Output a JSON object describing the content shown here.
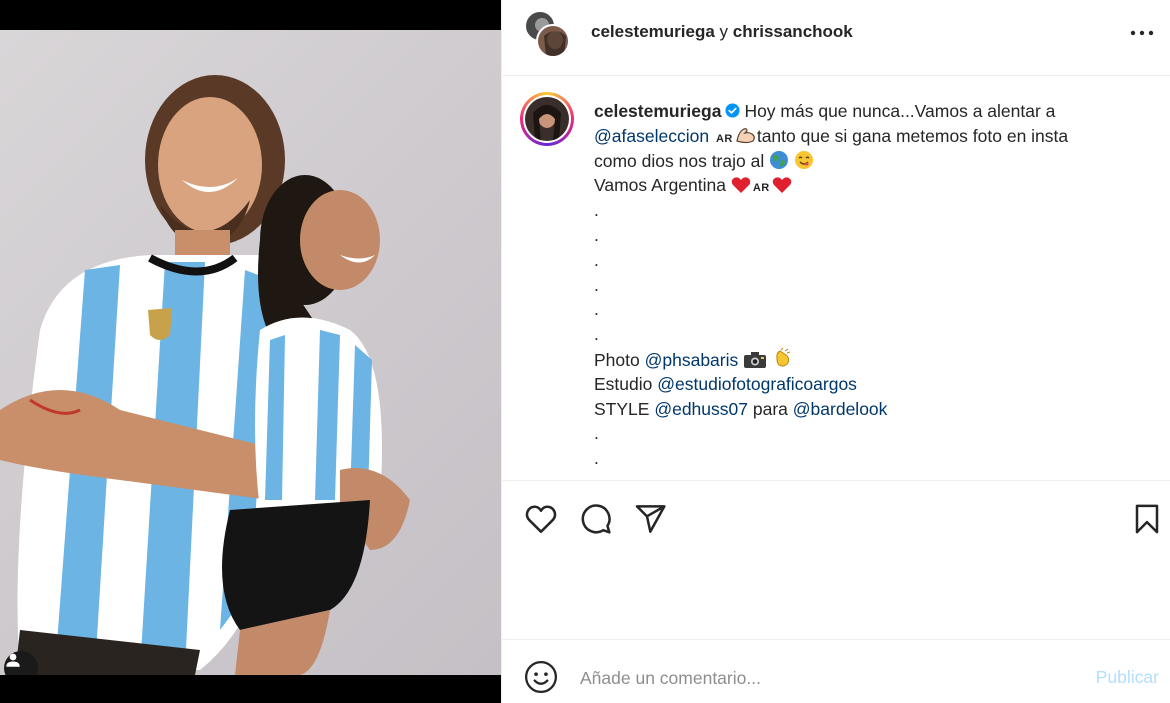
{
  "header": {
    "user1": "celestemuriega",
    "conjunction": "y",
    "user2": "chrissanchook",
    "more_icon": "ellipsis-horizontal-icon"
  },
  "caption": {
    "username": "celestemuriega",
    "line1": "Hoy más que nunca...Vamos a alentar a",
    "mention_afa": "@afaseleccion",
    "flag": "AR",
    "line2_tail": "tanto que si gana metemos foto en insta",
    "line3": "como dios nos trajo al",
    "line4": "Vamos Argentina",
    "dot": ".",
    "photo_label": "Photo",
    "photo_mention": "@phsabaris",
    "studio_label": "Estudio",
    "studio_mention": "@estudiofotograficoargos",
    "style_label": "STYLE",
    "style_mention": "@edhuss07",
    "para": "para",
    "bar_mention": "@bardelook"
  },
  "actions": {
    "like_icon": "heart-icon",
    "comment_icon": "comment-icon",
    "share_icon": "send-icon",
    "save_icon": "bookmark-icon"
  },
  "comment": {
    "placeholder": "Añade un comentario...",
    "publish_label": "Publicar"
  },
  "colors": {
    "mention": "#00376b",
    "verified": "#0095f6",
    "publish_disabled": "#b2dffc",
    "jersey_blue": "#6cb4e4"
  }
}
